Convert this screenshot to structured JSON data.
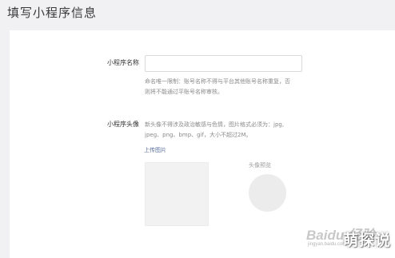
{
  "header": {
    "title": "填写小程序信息"
  },
  "form": {
    "name": {
      "label": "小程序名称",
      "value": "",
      "hint_lines": [
        "命名唯一限制：账号名称不得与平台其他账号名称重复，否",
        "则将不能通过平账号名称审核。"
      ]
    },
    "avatar": {
      "label": "小程序头像",
      "hint_lines": [
        "新头像不得涉及政治敏感与色情，图片格式必须为：jpg,",
        "jpeg、png、bmp、gif，大小不超过2M。"
      ],
      "upload_link": "上传图片",
      "preview_label": "头像预览"
    }
  },
  "watermark": {
    "baidu": "Baidu 经验",
    "url": "jingyan.baidu.com",
    "brand": "萌探说"
  }
}
